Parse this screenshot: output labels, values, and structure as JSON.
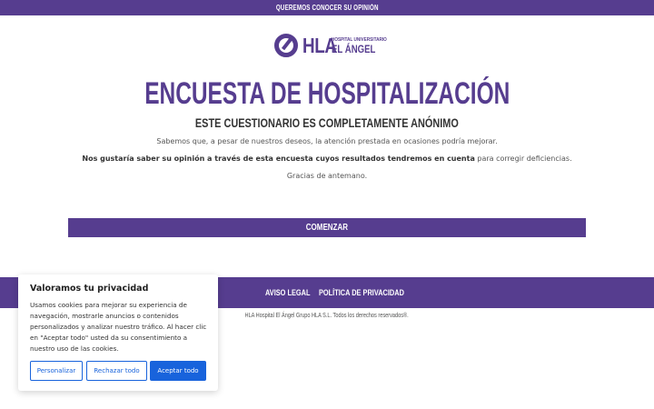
{
  "topbar": {
    "text": "QUEREMOS CONOCER SU OPINIÓN"
  },
  "logo": {
    "hla": "HLA",
    "line1": "HOSPITAL UNIVERSITARIO",
    "line2": "EL ÁNGEL"
  },
  "main": {
    "title": "ENCUESTA DE HOSPITALIZACIÓN",
    "subtitle": "ESTE CUESTIONARIO ES COMPLETAMENTE ANÓNIMO",
    "p1": "Sabemos que, a pesar de nuestros deseos, la atención prestada en ocasiones podría mejorar.",
    "p2_bold": "Nos gustaría saber su opinión a través de esta encuesta cuyos resultados tendremos en cuenta",
    "p2_rest": " para corregir deficiencias.",
    "p3": "Gracias de antemano.",
    "start_label": "COMENZAR"
  },
  "footer": {
    "link1": "AVISO LEGAL",
    "link2": "POLÍTICA DE PRIVACIDAD",
    "copyright": "HLA Hospital El Ángel Grupo HLA S.L. Todos los derechos reservados®."
  },
  "cookie": {
    "title": "Valoramos tu privacidad",
    "text": "Usamos cookies para mejorar su experiencia de navegación, mostrarle anuncios o contenidos personalizados y analizar nuestro tráfico. Al hacer clic en \"Aceptar todo\" usted da su consentimiento a nuestro uso de las cookies.",
    "btn_customize": "Personalizar",
    "btn_reject": "Rechazar todo",
    "btn_accept": "Aceptar todo"
  },
  "colors": {
    "brand": "#563d8f",
    "cookie_accent": "#1863dc"
  }
}
